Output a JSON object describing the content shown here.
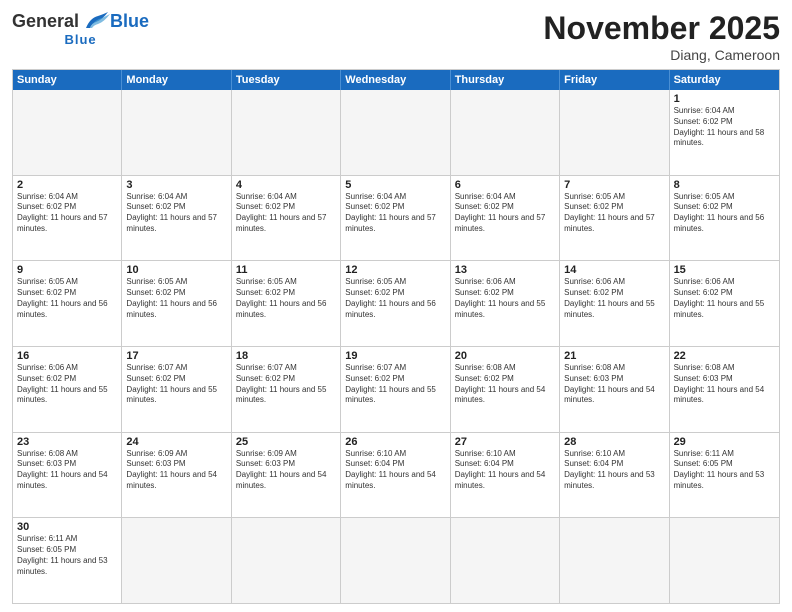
{
  "header": {
    "logo": {
      "general": "General",
      "blue": "Blue"
    },
    "title": "November 2025",
    "location": "Diang, Cameroon"
  },
  "dayNames": [
    "Sunday",
    "Monday",
    "Tuesday",
    "Wednesday",
    "Thursday",
    "Friday",
    "Saturday"
  ],
  "weeks": [
    [
      {
        "day": "",
        "empty": true
      },
      {
        "day": "",
        "empty": true
      },
      {
        "day": "",
        "empty": true
      },
      {
        "day": "",
        "empty": true
      },
      {
        "day": "",
        "empty": true
      },
      {
        "day": "",
        "empty": true
      },
      {
        "day": "1",
        "sunrise": "6:04 AM",
        "sunset": "6:02 PM",
        "daylight": "11 hours and 58 minutes."
      }
    ],
    [
      {
        "day": "2",
        "sunrise": "6:04 AM",
        "sunset": "6:02 PM",
        "daylight": "11 hours and 57 minutes."
      },
      {
        "day": "3",
        "sunrise": "6:04 AM",
        "sunset": "6:02 PM",
        "daylight": "11 hours and 57 minutes."
      },
      {
        "day": "4",
        "sunrise": "6:04 AM",
        "sunset": "6:02 PM",
        "daylight": "11 hours and 57 minutes."
      },
      {
        "day": "5",
        "sunrise": "6:04 AM",
        "sunset": "6:02 PM",
        "daylight": "11 hours and 57 minutes."
      },
      {
        "day": "6",
        "sunrise": "6:04 AM",
        "sunset": "6:02 PM",
        "daylight": "11 hours and 57 minutes."
      },
      {
        "day": "7",
        "sunrise": "6:05 AM",
        "sunset": "6:02 PM",
        "daylight": "11 hours and 57 minutes."
      },
      {
        "day": "8",
        "sunrise": "6:05 AM",
        "sunset": "6:02 PM",
        "daylight": "11 hours and 56 minutes."
      }
    ],
    [
      {
        "day": "9",
        "sunrise": "6:05 AM",
        "sunset": "6:02 PM",
        "daylight": "11 hours and 56 minutes."
      },
      {
        "day": "10",
        "sunrise": "6:05 AM",
        "sunset": "6:02 PM",
        "daylight": "11 hours and 56 minutes."
      },
      {
        "day": "11",
        "sunrise": "6:05 AM",
        "sunset": "6:02 PM",
        "daylight": "11 hours and 56 minutes."
      },
      {
        "day": "12",
        "sunrise": "6:05 AM",
        "sunset": "6:02 PM",
        "daylight": "11 hours and 56 minutes."
      },
      {
        "day": "13",
        "sunrise": "6:06 AM",
        "sunset": "6:02 PM",
        "daylight": "11 hours and 55 minutes."
      },
      {
        "day": "14",
        "sunrise": "6:06 AM",
        "sunset": "6:02 PM",
        "daylight": "11 hours and 55 minutes."
      },
      {
        "day": "15",
        "sunrise": "6:06 AM",
        "sunset": "6:02 PM",
        "daylight": "11 hours and 55 minutes."
      }
    ],
    [
      {
        "day": "16",
        "sunrise": "6:06 AM",
        "sunset": "6:02 PM",
        "daylight": "11 hours and 55 minutes."
      },
      {
        "day": "17",
        "sunrise": "6:07 AM",
        "sunset": "6:02 PM",
        "daylight": "11 hours and 55 minutes."
      },
      {
        "day": "18",
        "sunrise": "6:07 AM",
        "sunset": "6:02 PM",
        "daylight": "11 hours and 55 minutes."
      },
      {
        "day": "19",
        "sunrise": "6:07 AM",
        "sunset": "6:02 PM",
        "daylight": "11 hours and 55 minutes."
      },
      {
        "day": "20",
        "sunrise": "6:08 AM",
        "sunset": "6:02 PM",
        "daylight": "11 hours and 54 minutes."
      },
      {
        "day": "21",
        "sunrise": "6:08 AM",
        "sunset": "6:03 PM",
        "daylight": "11 hours and 54 minutes."
      },
      {
        "day": "22",
        "sunrise": "6:08 AM",
        "sunset": "6:03 PM",
        "daylight": "11 hours and 54 minutes."
      }
    ],
    [
      {
        "day": "23",
        "sunrise": "6:08 AM",
        "sunset": "6:03 PM",
        "daylight": "11 hours and 54 minutes."
      },
      {
        "day": "24",
        "sunrise": "6:09 AM",
        "sunset": "6:03 PM",
        "daylight": "11 hours and 54 minutes."
      },
      {
        "day": "25",
        "sunrise": "6:09 AM",
        "sunset": "6:03 PM",
        "daylight": "11 hours and 54 minutes."
      },
      {
        "day": "26",
        "sunrise": "6:10 AM",
        "sunset": "6:04 PM",
        "daylight": "11 hours and 54 minutes."
      },
      {
        "day": "27",
        "sunrise": "6:10 AM",
        "sunset": "6:04 PM",
        "daylight": "11 hours and 54 minutes."
      },
      {
        "day": "28",
        "sunrise": "6:10 AM",
        "sunset": "6:04 PM",
        "daylight": "11 hours and 53 minutes."
      },
      {
        "day": "29",
        "sunrise": "6:11 AM",
        "sunset": "6:05 PM",
        "daylight": "11 hours and 53 minutes."
      }
    ],
    [
      {
        "day": "30",
        "sunrise": "6:11 AM",
        "sunset": "6:05 PM",
        "daylight": "11 hours and 53 minutes."
      },
      {
        "day": "",
        "empty": true
      },
      {
        "day": "",
        "empty": true
      },
      {
        "day": "",
        "empty": true
      },
      {
        "day": "",
        "empty": true
      },
      {
        "day": "",
        "empty": true
      },
      {
        "day": "",
        "empty": true
      }
    ]
  ]
}
